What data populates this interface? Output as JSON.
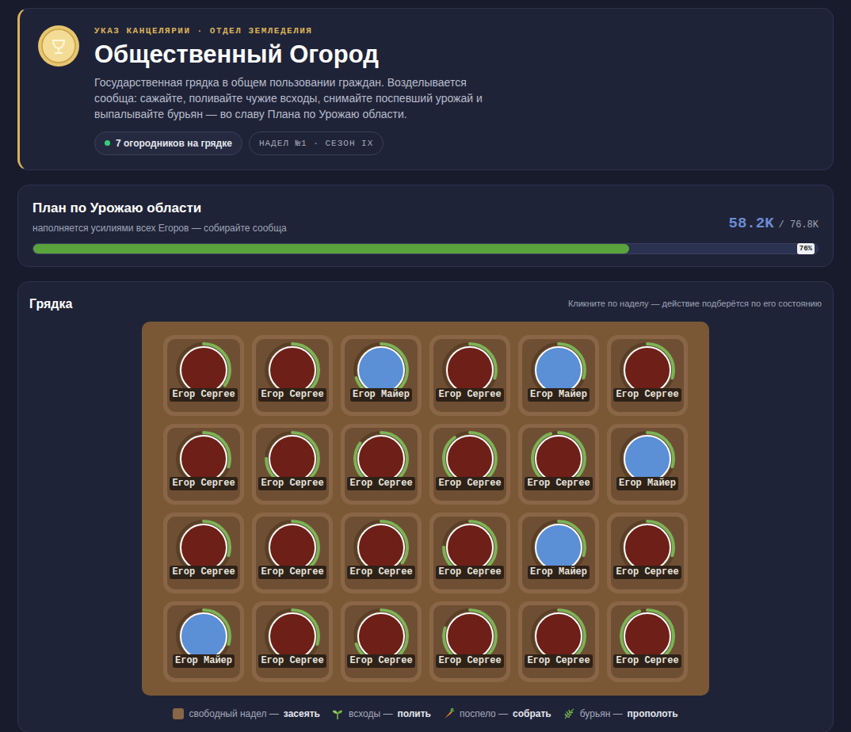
{
  "header": {
    "eyebrow": "УКАЗ КАНЦЕЛЯРИИ · ОТДЕЛ ЗЕМЛЕДЕЛИЯ",
    "title": "Общественный Огород",
    "description": "Государственная грядка в общем пользовании граждан. Возделывается сообща: сажайте, поливайте чужие всходы, снимайте поспевший урожай и выпалывайте бурьян — во славу Плана по Урожаю области.",
    "online": "7 огородников на грядке",
    "plot_tag": "НАДЕЛ №1 · СЕЗОН IX"
  },
  "plan": {
    "title": "План по Урожаю области",
    "subtitle": "наполняется усилиями всех Егоров — собирайте сообща",
    "current": "58.2K",
    "total": "/ 76.8K",
    "level": 0.76,
    "percent": "76%"
  },
  "garden": {
    "title": "Грядка",
    "hint": "Кликните по наделу — действие подберётся по его состоянию",
    "plots": [
      {
        "name": "Егор Сергее",
        "color": "#6e1f17",
        "level": 0.35
      },
      {
        "name": "Егор Сергее",
        "color": "#6e1f17",
        "level": 0.4
      },
      {
        "name": "Егор Майер",
        "color": "#5b8fd6",
        "level": 0.7
      },
      {
        "name": "Егор Сергее",
        "color": "#6e1f17",
        "level": 0.3
      },
      {
        "name": "Егор Майер",
        "color": "#5b8fd6",
        "level": 0.3
      },
      {
        "name": "Егор Сергее",
        "color": "#6e1f17",
        "level": 0.3
      },
      {
        "name": "Егор Сергее",
        "color": "#6e1f17",
        "level": 0.3
      },
      {
        "name": "Егор Сергее",
        "color": "#6e1f17",
        "level": 0.75
      },
      {
        "name": "Егор Сергее",
        "color": "#6e1f17",
        "level": 0.85
      },
      {
        "name": "Егор Сергее",
        "color": "#6e1f17",
        "level": 0.9
      },
      {
        "name": "Егор Сергее",
        "color": "#6e1f17",
        "level": 0.95
      },
      {
        "name": "Егор Майер",
        "color": "#5b8fd6",
        "level": 0.3
      },
      {
        "name": "Егор Сергее",
        "color": "#6e1f17",
        "level": 0.3
      },
      {
        "name": "Егор Сергее",
        "color": "#6e1f17",
        "level": 0.4
      },
      {
        "name": "Егор Сергее",
        "color": "#6e1f17",
        "level": 0.35
      },
      {
        "name": "Егор Сергее",
        "color": "#6e1f17",
        "level": 0.75
      },
      {
        "name": "Егор Майер",
        "color": "#5b8fd6",
        "level": 0.3
      },
      {
        "name": "Егор Сергее",
        "color": "#6e1f17",
        "level": 0.3
      },
      {
        "name": "Егор Майер",
        "color": "#5b8fd6",
        "level": 0.3
      },
      {
        "name": "Егор Сергее",
        "color": "#6e1f17",
        "level": 0.3
      },
      {
        "name": "Егор Сергее",
        "color": "#6e1f17",
        "level": 0.7
      },
      {
        "name": "Егор Сергее",
        "color": "#6e1f17",
        "level": 0.8
      },
      {
        "name": "Егор Сергее",
        "color": "#6e1f17",
        "level": 0.6
      },
      {
        "name": "Егор Сергее",
        "color": "#6e1f17",
        "level": 0.95
      }
    ]
  },
  "legend": [
    {
      "kind": "free",
      "label": "свободный надел —",
      "action": "засеять"
    },
    {
      "kind": "sprout",
      "label": "всходы —",
      "action": "полить"
    },
    {
      "kind": "ripe",
      "label": "поспело —",
      "action": "собрать"
    },
    {
      "kind": "weed",
      "label": "бурьян —",
      "action": "прополоть"
    }
  ]
}
